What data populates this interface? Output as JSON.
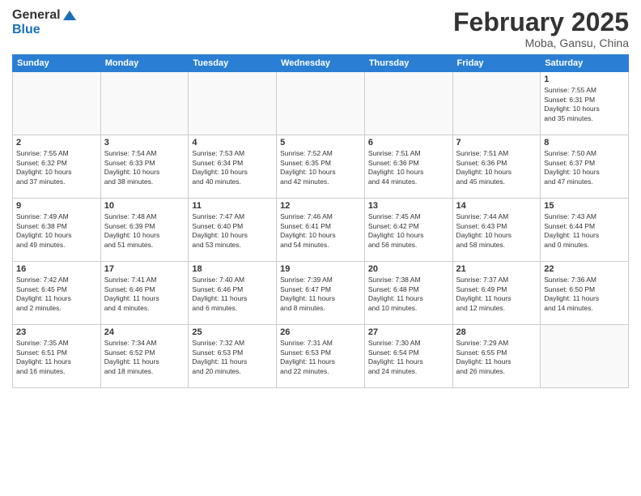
{
  "header": {
    "logo_general": "General",
    "logo_blue": "Blue",
    "month_title": "February 2025",
    "location": "Moba, Gansu, China"
  },
  "days_of_week": [
    "Sunday",
    "Monday",
    "Tuesday",
    "Wednesday",
    "Thursday",
    "Friday",
    "Saturday"
  ],
  "weeks": [
    [
      {
        "day": "",
        "text": ""
      },
      {
        "day": "",
        "text": ""
      },
      {
        "day": "",
        "text": ""
      },
      {
        "day": "",
        "text": ""
      },
      {
        "day": "",
        "text": ""
      },
      {
        "day": "",
        "text": ""
      },
      {
        "day": "1",
        "text": "Sunrise: 7:55 AM\nSunset: 6:31 PM\nDaylight: 10 hours\nand 35 minutes."
      }
    ],
    [
      {
        "day": "2",
        "text": "Sunrise: 7:55 AM\nSunset: 6:32 PM\nDaylight: 10 hours\nand 37 minutes."
      },
      {
        "day": "3",
        "text": "Sunrise: 7:54 AM\nSunset: 6:33 PM\nDaylight: 10 hours\nand 38 minutes."
      },
      {
        "day": "4",
        "text": "Sunrise: 7:53 AM\nSunset: 6:34 PM\nDaylight: 10 hours\nand 40 minutes."
      },
      {
        "day": "5",
        "text": "Sunrise: 7:52 AM\nSunset: 6:35 PM\nDaylight: 10 hours\nand 42 minutes."
      },
      {
        "day": "6",
        "text": "Sunrise: 7:51 AM\nSunset: 6:36 PM\nDaylight: 10 hours\nand 44 minutes."
      },
      {
        "day": "7",
        "text": "Sunrise: 7:51 AM\nSunset: 6:36 PM\nDaylight: 10 hours\nand 45 minutes."
      },
      {
        "day": "8",
        "text": "Sunrise: 7:50 AM\nSunset: 6:37 PM\nDaylight: 10 hours\nand 47 minutes."
      }
    ],
    [
      {
        "day": "9",
        "text": "Sunrise: 7:49 AM\nSunset: 6:38 PM\nDaylight: 10 hours\nand 49 minutes."
      },
      {
        "day": "10",
        "text": "Sunrise: 7:48 AM\nSunset: 6:39 PM\nDaylight: 10 hours\nand 51 minutes."
      },
      {
        "day": "11",
        "text": "Sunrise: 7:47 AM\nSunset: 6:40 PM\nDaylight: 10 hours\nand 53 minutes."
      },
      {
        "day": "12",
        "text": "Sunrise: 7:46 AM\nSunset: 6:41 PM\nDaylight: 10 hours\nand 54 minutes."
      },
      {
        "day": "13",
        "text": "Sunrise: 7:45 AM\nSunset: 6:42 PM\nDaylight: 10 hours\nand 56 minutes."
      },
      {
        "day": "14",
        "text": "Sunrise: 7:44 AM\nSunset: 6:43 PM\nDaylight: 10 hours\nand 58 minutes."
      },
      {
        "day": "15",
        "text": "Sunrise: 7:43 AM\nSunset: 6:44 PM\nDaylight: 11 hours\nand 0 minutes."
      }
    ],
    [
      {
        "day": "16",
        "text": "Sunrise: 7:42 AM\nSunset: 6:45 PM\nDaylight: 11 hours\nand 2 minutes."
      },
      {
        "day": "17",
        "text": "Sunrise: 7:41 AM\nSunset: 6:46 PM\nDaylight: 11 hours\nand 4 minutes."
      },
      {
        "day": "18",
        "text": "Sunrise: 7:40 AM\nSunset: 6:46 PM\nDaylight: 11 hours\nand 6 minutes."
      },
      {
        "day": "19",
        "text": "Sunrise: 7:39 AM\nSunset: 6:47 PM\nDaylight: 11 hours\nand 8 minutes."
      },
      {
        "day": "20",
        "text": "Sunrise: 7:38 AM\nSunset: 6:48 PM\nDaylight: 11 hours\nand 10 minutes."
      },
      {
        "day": "21",
        "text": "Sunrise: 7:37 AM\nSunset: 6:49 PM\nDaylight: 11 hours\nand 12 minutes."
      },
      {
        "day": "22",
        "text": "Sunrise: 7:36 AM\nSunset: 6:50 PM\nDaylight: 11 hours\nand 14 minutes."
      }
    ],
    [
      {
        "day": "23",
        "text": "Sunrise: 7:35 AM\nSunset: 6:51 PM\nDaylight: 11 hours\nand 16 minutes."
      },
      {
        "day": "24",
        "text": "Sunrise: 7:34 AM\nSunset: 6:52 PM\nDaylight: 11 hours\nand 18 minutes."
      },
      {
        "day": "25",
        "text": "Sunrise: 7:32 AM\nSunset: 6:53 PM\nDaylight: 11 hours\nand 20 minutes."
      },
      {
        "day": "26",
        "text": "Sunrise: 7:31 AM\nSunset: 6:53 PM\nDaylight: 11 hours\nand 22 minutes."
      },
      {
        "day": "27",
        "text": "Sunrise: 7:30 AM\nSunset: 6:54 PM\nDaylight: 11 hours\nand 24 minutes."
      },
      {
        "day": "28",
        "text": "Sunrise: 7:29 AM\nSunset: 6:55 PM\nDaylight: 11 hours\nand 26 minutes."
      },
      {
        "day": "",
        "text": ""
      }
    ]
  ]
}
